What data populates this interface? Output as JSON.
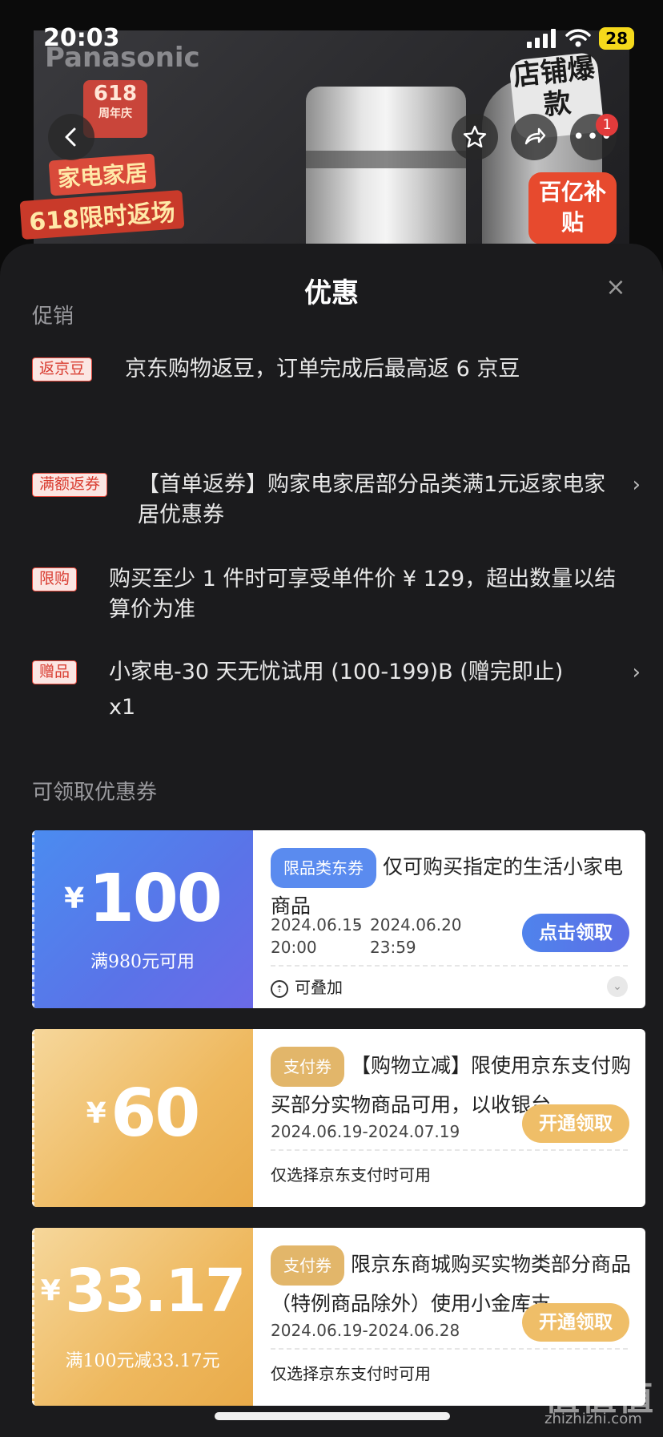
{
  "status_bar": {
    "time": "20:03",
    "battery": "28"
  },
  "hero": {
    "brand": "Panasonic",
    "promo_618": "618",
    "promo_618_sub": "周年庆",
    "promo_line1": "家电家居",
    "promo_line2": "618限时返场",
    "store_badge": "店铺爆款",
    "subsidy_badge": "百亿补贴",
    "notification_count": "1"
  },
  "sheet": {
    "title": "优惠",
    "promotions_label": "促销",
    "promotions": [
      {
        "tag": "返京豆",
        "text": "京东购物返豆，订单完成后最高返 6 京豆"
      },
      {
        "tag": "满额返券",
        "text": "【首单返券】购家电家居部分品类满1元返家电家居优惠券"
      },
      {
        "tag": "限购",
        "text": "购买至少 1 件时可享受单件价 ¥ 129，超出数量以结算价为准"
      },
      {
        "tag": "赠品",
        "text": "小家电-30 天无忧试用 (100-199)B (赠完即止)",
        "qty": "x1"
      }
    ],
    "coupons_label": "可领取优惠券",
    "coupons": [
      {
        "currency": "¥",
        "amount": "100",
        "condition": "满980元可用",
        "tag": "限品类东券",
        "title": "仅可购买指定的生活小家电商品",
        "date_start": "2024.06.15",
        "date_start_time": "20:00",
        "date_end": "2024.06.20",
        "date_end_time": "23:59",
        "button": "点击领取",
        "footer": "可叠加"
      },
      {
        "currency": "¥",
        "amount": "60",
        "tag": "支付券",
        "title": "【购物立减】限使用京东支付购买部分实物商品可用，以收银台...",
        "date": "2024.06.19-2024.07.19",
        "button": "开通领取",
        "footer": "仅选择京东支付时可用"
      },
      {
        "currency": "¥",
        "amount": "33.17",
        "condition": "满100元减33.17元",
        "tag": "支付券",
        "title": "限京东商城购买实物类部分商品（特例商品除外）使用小金库支...",
        "date": "2024.06.19-2024.06.28",
        "button": "开通领取",
        "footer": "仅选择京东支付时可用"
      }
    ]
  },
  "watermark": {
    "main": "值值值",
    "sub": "zhizhizhi.com"
  },
  "colors": {
    "tag_red": "#e2483c",
    "coupon_blue": "#5a8bef",
    "coupon_gold": "#e9ab4a",
    "sheet_bg": "#1b1b1d"
  }
}
